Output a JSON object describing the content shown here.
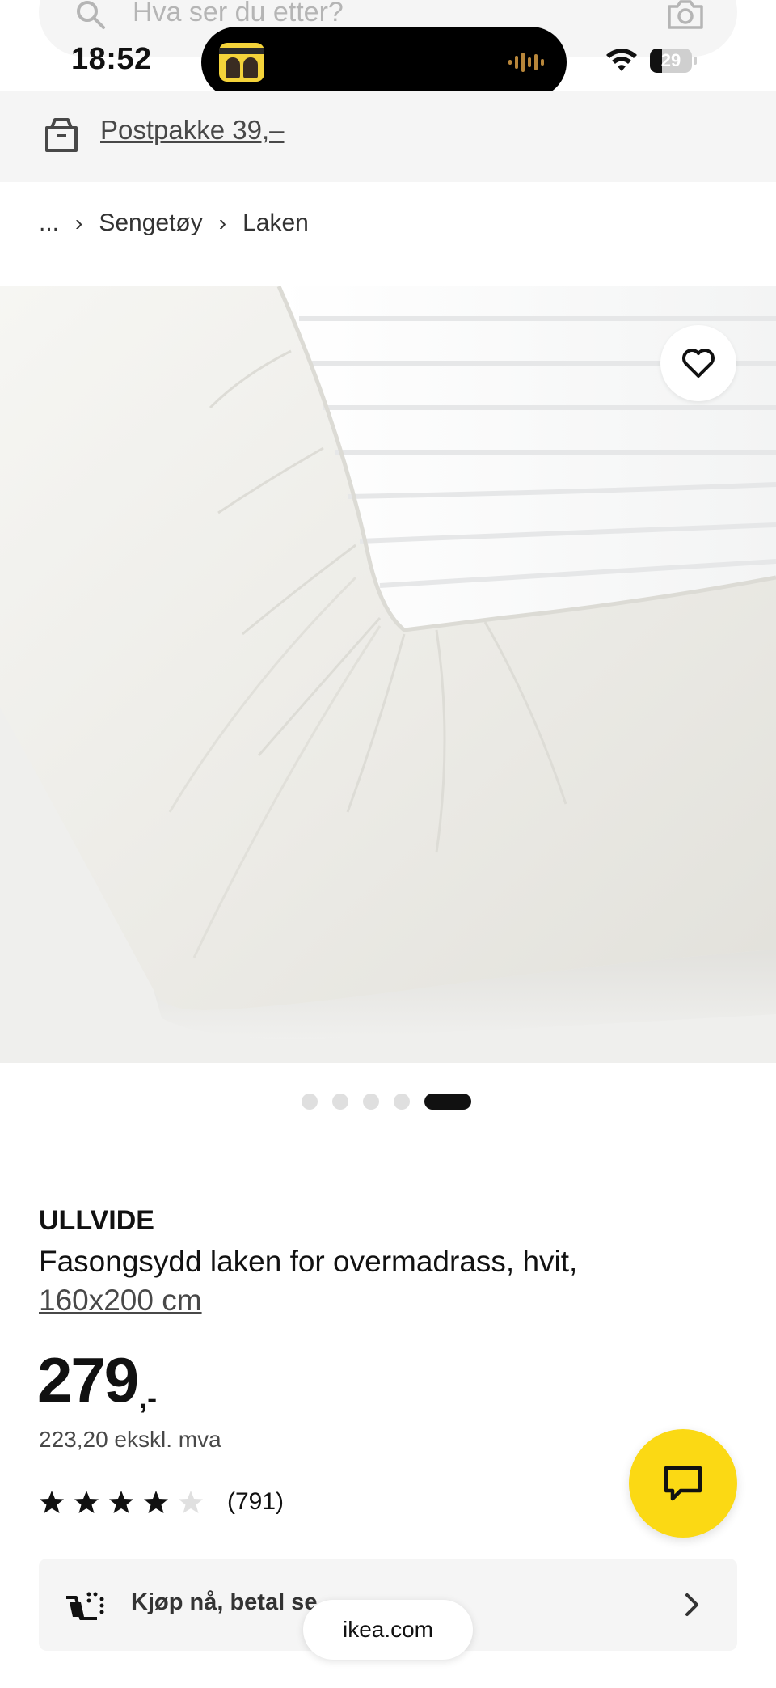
{
  "status_bar": {
    "time": "18:52",
    "battery_percent": "29",
    "battery_level": 0.29
  },
  "search": {
    "placeholder": "Hva ser du etter?",
    "icon": "search-icon",
    "camera_icon": "camera-icon"
  },
  "delivery": {
    "icon": "delivery-box-icon",
    "label": "Postpakke 39,–"
  },
  "breadcrumb": {
    "items": [
      "...",
      "Sengetøy",
      "Laken"
    ]
  },
  "gallery": {
    "image_count": 5,
    "active_index": 4,
    "favorite_icon": "heart-icon"
  },
  "product": {
    "brand": "ULLVIDE",
    "description": "Fasongsydd laken for overmadrass, hvit,",
    "size": "160x200 cm",
    "price": "279",
    "price_suffix": ",-",
    "price_ex_vat": "223,20 ekskl. mva",
    "rating": 4,
    "rating_max": 5,
    "review_count": "(791)"
  },
  "chat": {
    "icon": "chat-icon"
  },
  "pay_later": {
    "label": "Kjøp nå, betal se...",
    "icon": "cart-icon"
  },
  "browser": {
    "url": "ikea.com"
  },
  "colors": {
    "accent_yellow": "#FBD914",
    "text": "#111111",
    "muted_text": "#484848",
    "banner_bg": "#F5F5F5"
  }
}
